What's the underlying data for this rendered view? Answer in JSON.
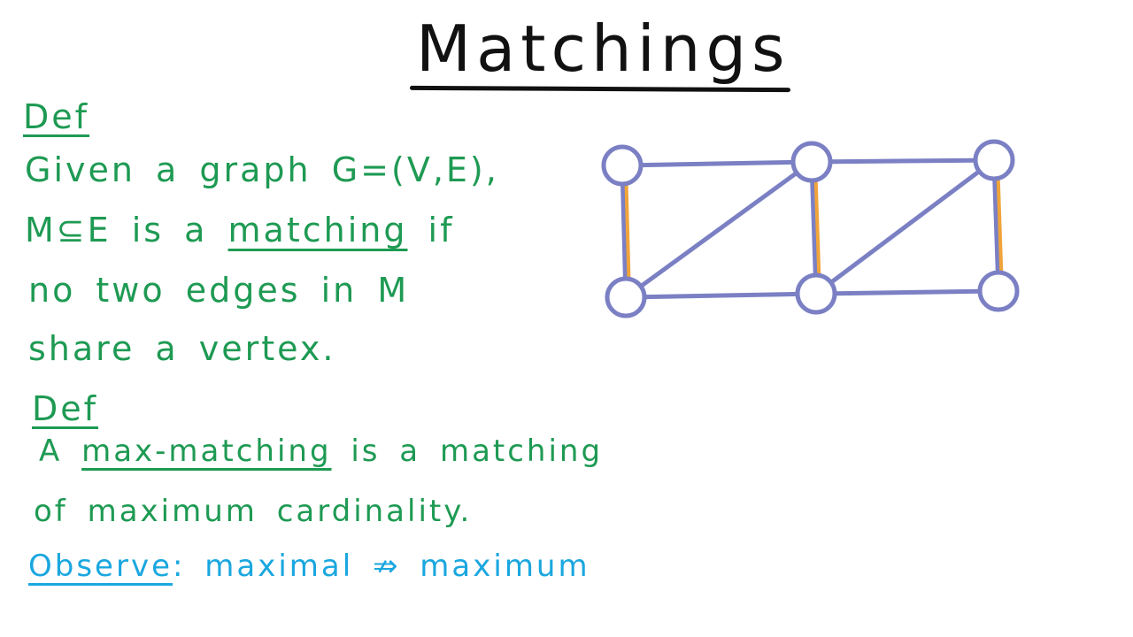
{
  "title": "Matchings",
  "definitions": [
    {
      "heading": "Def",
      "lines": [
        {
          "text": "Given a graph G=(V,E),"
        },
        {
          "before": "M⊆E is a ",
          "term": "matching",
          "after": " if"
        },
        {
          "text": "no two edges in M"
        },
        {
          "text": "share a vertex."
        }
      ]
    },
    {
      "heading": "Def",
      "lines": [
        {
          "before": "A ",
          "term": "max-matching",
          "after": " is a matching"
        },
        {
          "text": "of maximum cardinality."
        }
      ]
    }
  ],
  "observe": {
    "label": "Observe",
    "text": ": maximal ⇏ maximum"
  },
  "colors": {
    "green_ink": "#1e9a53",
    "blue_ink": "#1aa7df",
    "graph_edge": "#7b80c4",
    "matching_edge": "#f0a43a",
    "title_ink": "#111111"
  },
  "graph": {
    "vertices": [
      "v1",
      "v2",
      "v3",
      "v4",
      "v5",
      "v6"
    ],
    "edges": [
      [
        "v1",
        "v2"
      ],
      [
        "v2",
        "v3"
      ],
      [
        "v4",
        "v5"
      ],
      [
        "v5",
        "v6"
      ],
      [
        "v1",
        "v4"
      ],
      [
        "v2",
        "v5"
      ],
      [
        "v3",
        "v6"
      ],
      [
        "v4",
        "v2"
      ],
      [
        "v5",
        "v3"
      ]
    ],
    "matching": [
      [
        "v1",
        "v4"
      ],
      [
        "v2",
        "v5"
      ],
      [
        "v3",
        "v6"
      ]
    ]
  }
}
